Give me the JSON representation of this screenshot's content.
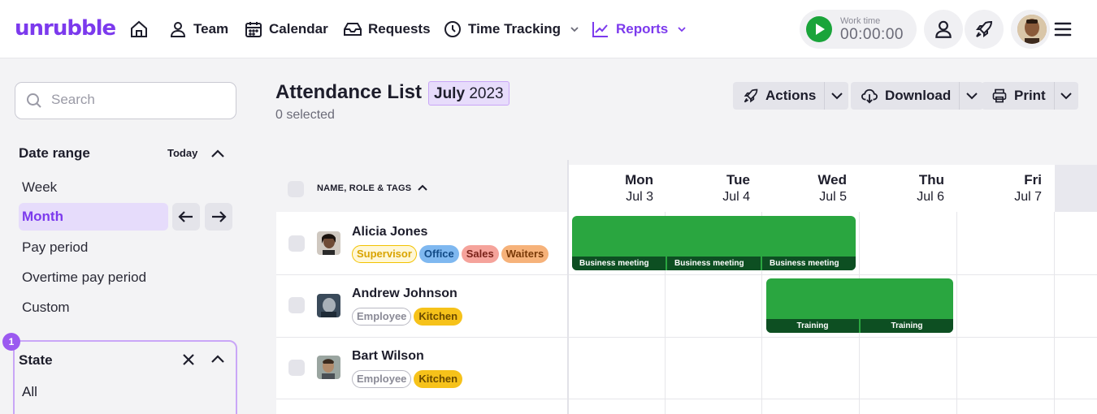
{
  "brand": "unrubble",
  "nav": [
    {
      "label": "Team"
    },
    {
      "label": "Calendar"
    },
    {
      "label": "Requests"
    },
    {
      "label": "Time Tracking"
    },
    {
      "label": "Reports"
    }
  ],
  "work_time": {
    "label": "Work time",
    "value": "00:00:00"
  },
  "sidebar": {
    "search_placeholder": "Search",
    "date_range": {
      "title": "Date range",
      "today": "Today",
      "options": [
        "Week",
        "Month",
        "Pay period",
        "Overtime pay period",
        "Custom"
      ]
    },
    "state": {
      "badge": "1",
      "title": "State",
      "value": "All"
    }
  },
  "page": {
    "title": "Attendance List",
    "month_name": "July",
    "month_year": "2023",
    "selected": "0 selected",
    "actions": "Actions",
    "download": "Download",
    "print": "Print"
  },
  "table": {
    "name_header": "NAME, ROLE & TAGS",
    "days": [
      {
        "dow": "Mon",
        "date": "Jul 3"
      },
      {
        "dow": "Tue",
        "date": "Jul 4"
      },
      {
        "dow": "Wed",
        "date": "Jul 5"
      },
      {
        "dow": "Thu",
        "date": "Jul 6"
      },
      {
        "dow": "Fri",
        "date": "Jul 7"
      }
    ],
    "rows": [
      {
        "name": "Alicia Jones",
        "tags": [
          "Supervisor",
          "Office",
          "Sales",
          "Waiters"
        ]
      },
      {
        "name": "Andrew Johnson",
        "tags": [
          "Employee",
          "Kitchen"
        ]
      },
      {
        "name": "Bart Wilson",
        "tags": [
          "Employee",
          "Kitchen"
        ]
      }
    ],
    "shifts": [
      {
        "row": 0,
        "labels": [
          "Business meeting",
          "Business meeting",
          "Business meeting"
        ]
      },
      {
        "row": 1,
        "labels": [
          "Training",
          "Training"
        ]
      }
    ]
  },
  "colors": {
    "accent": "#7c3aed",
    "shift_green": "#2aa640",
    "shift_label": "#0d4f22",
    "play": "#1aa43a"
  }
}
